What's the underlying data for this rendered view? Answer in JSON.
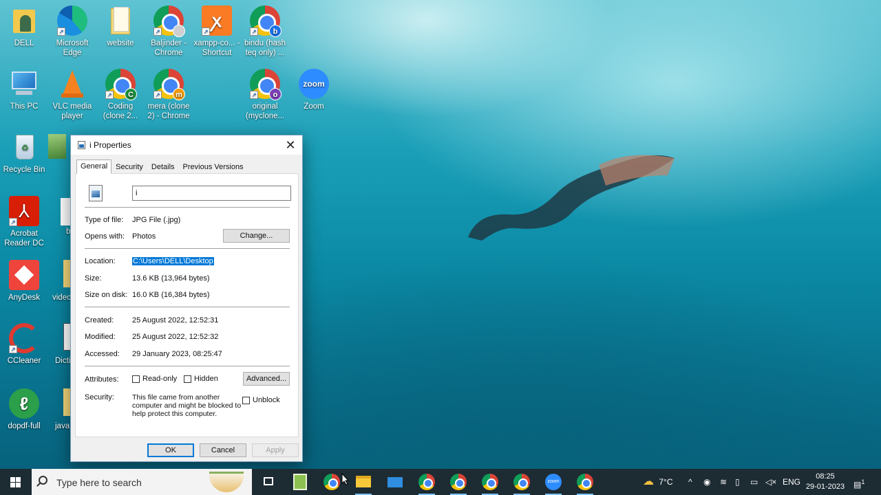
{
  "desktop": {
    "icons": [
      {
        "label": "DELL",
        "icon": "user-folder-icon"
      },
      {
        "label": "Microsoft Edge",
        "icon": "edge-icon"
      },
      {
        "label": "website",
        "icon": "folder-icon"
      },
      {
        "label": "Baljinder - Chrome",
        "icon": "chrome-icon"
      },
      {
        "label": "xampp-co... - Shortcut",
        "icon": "xampp-icon"
      },
      {
        "label": "bindu (hash teq only) ...",
        "icon": "chrome-icon",
        "badge": "b"
      },
      {
        "label": "This PC",
        "icon": "computer-icon"
      },
      {
        "label": "VLC media player",
        "icon": "vlc-icon"
      },
      {
        "label": "Coding (clone 2...",
        "icon": "chrome-icon",
        "badge": "C"
      },
      {
        "label": "mera (clone 2) - Chrome",
        "icon": "chrome-icon",
        "badge": "m"
      },
      {
        "label": "original (myclone...",
        "icon": "chrome-icon",
        "badge": "o"
      },
      {
        "label": "Zoom",
        "icon": "zoom-icon",
        "glyph": "zoom"
      },
      {
        "label": "Recycle Bin",
        "icon": "recycle-bin-icon"
      },
      {
        "label": "Acrobat Reader DC",
        "icon": "acrobat-icon"
      },
      {
        "label": "AnyDesk",
        "icon": "anydesk-icon"
      },
      {
        "label": "videc",
        "icon": "folder-icon"
      },
      {
        "label": "CCleaner",
        "icon": "ccleaner-icon"
      },
      {
        "label": "Dicti",
        "icon": "document-icon"
      },
      {
        "label": "dopdf-full",
        "icon": "dopdf-icon"
      },
      {
        "label": "java",
        "icon": "folder-icon"
      },
      {
        "label": "b",
        "icon": "file-icon"
      }
    ]
  },
  "dialog": {
    "title": "i Properties",
    "tabs": [
      {
        "label": "General",
        "active": true
      },
      {
        "label": "Security",
        "active": false
      },
      {
        "label": "Details",
        "active": false
      },
      {
        "label": "Previous Versions",
        "active": false
      }
    ],
    "filename": "i",
    "type_label": "Type of file:",
    "type_value": "JPG File (.jpg)",
    "opens_label": "Opens with:",
    "opens_value": "Photos",
    "change_button": "Change...",
    "location_label": "Location:",
    "location_value": "C:\\Users\\DELL\\Desktop",
    "size_label": "Size:",
    "size_value": "13.6 KB (13,964 bytes)",
    "size_on_disk_label": "Size on disk:",
    "size_on_disk_value": "16.0 KB (16,384 bytes)",
    "created_label": "Created:",
    "created_value": "25 August 2022, 12:52:31",
    "modified_label": "Modified:",
    "modified_value": "25 August 2022, 12:52:32",
    "accessed_label": "Accessed:",
    "accessed_value": "29 January 2023, 08:25:47",
    "attributes_label": "Attributes:",
    "readonly_label": "Read-only",
    "hidden_label": "Hidden",
    "advanced_button": "Advanced...",
    "security_label": "Security:",
    "security_text_1": "This file came from another",
    "security_text_2": "computer and might be blocked to",
    "security_text_3": "help protect this computer.",
    "unblock_label": "Unblock",
    "ok_button": "OK",
    "cancel_button": "Cancel",
    "apply_button": "Apply",
    "close_glyph": "✕"
  },
  "taskbar": {
    "search_placeholder": "Type here to search",
    "weather": "7°C",
    "language": "ENG",
    "time": "08:25",
    "date": "29-01-2023",
    "notification_count": "1",
    "zoom_label": "zoom",
    "accent": "#1d2b33"
  }
}
